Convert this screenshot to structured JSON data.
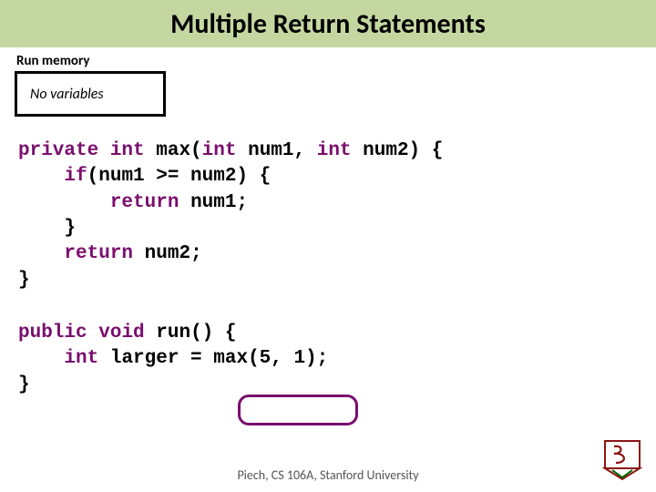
{
  "title": "Multiple Return Statements",
  "memory": {
    "label": "Run memory",
    "content": "No variables"
  },
  "code": {
    "kw_private": "private",
    "kw_int1": "int",
    "fn_max": "max(",
    "kw_int2": "int",
    "p_num1": "num1,",
    "kw_int3": "int",
    "p_num2": "num2) {",
    "kw_if": "if",
    "cond": "(num1 >= num2) {",
    "kw_return1": "return",
    "r1": "num1;",
    "close1": "}",
    "kw_return2": "return",
    "r2": "num2;",
    "close2": "}",
    "kw_public": "public",
    "kw_void": "void",
    "fn_run": "run() {",
    "kw_int4": "int",
    "larger": "larger = max(5, 1);",
    "close3": "}"
  },
  "footer": "Piech, CS 106A, Stanford University"
}
